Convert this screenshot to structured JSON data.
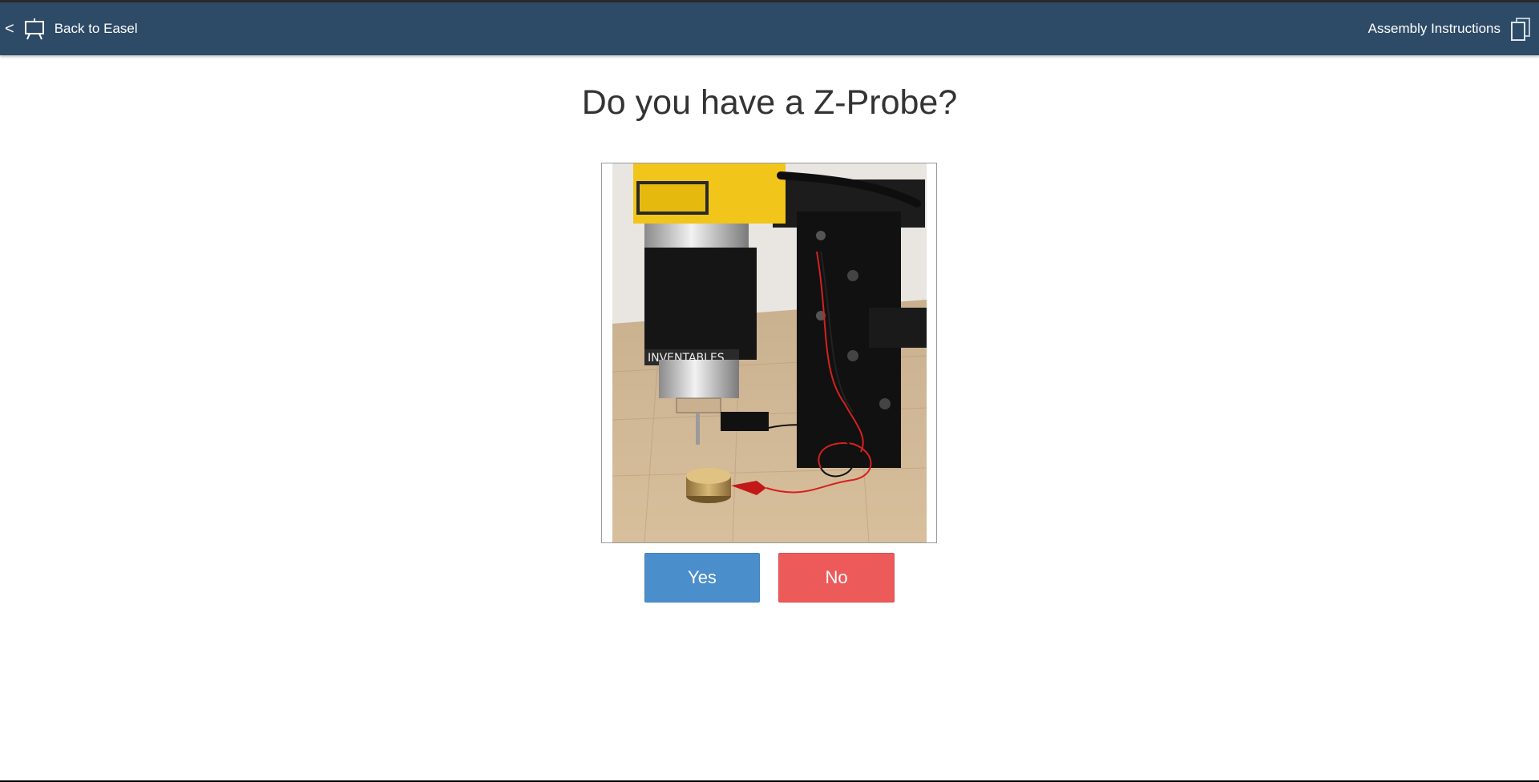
{
  "header": {
    "back_arrow": "<",
    "back_label": "Back to Easel",
    "back_icon": "easel-icon",
    "assembly_label": "Assembly Instructions",
    "assembly_icon": "documents-icon",
    "background_color": "#2d4a66"
  },
  "main": {
    "question": "Do you have a Z-Probe?",
    "image_subject": "CNC router spindle with Z-probe puck and clip on wooden wasteboard",
    "image_logo_text": "INVENTABLES"
  },
  "buttons": {
    "yes_label": "Yes",
    "no_label": "No",
    "yes_color": "#4a8ecc",
    "no_color": "#ec5a5a"
  }
}
